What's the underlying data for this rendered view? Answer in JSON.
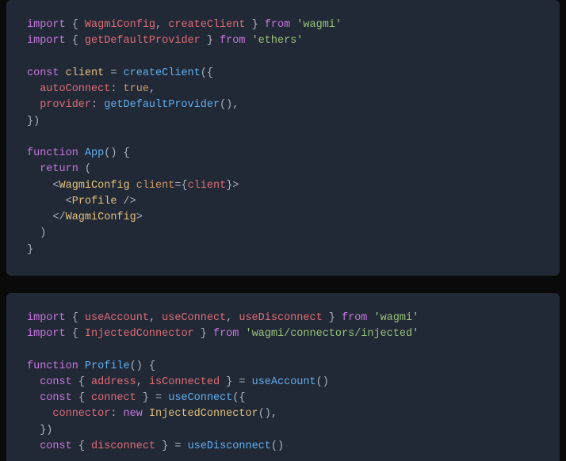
{
  "block1": {
    "l1_import": "import",
    "l1_lbrace": " { ",
    "l1_a": "WagmiConfig",
    "l1_comma": ", ",
    "l1_b": "createClient",
    "l1_rbrace": " } ",
    "l1_from": "from",
    "l1_sp": " ",
    "l1_str": "'wagmi'",
    "l2_import": "import",
    "l2_lbrace": " { ",
    "l2_a": "getDefaultProvider",
    "l2_rbrace": " } ",
    "l2_from": "from",
    "l2_sp": " ",
    "l2_str": "'ethers'",
    "l4_const": "const",
    "l4_sp1": " ",
    "l4_client": "client",
    "l4_eq": " = ",
    "l4_fn": "createClient",
    "l4_open": "({",
    "l5_pad": "  ",
    "l5_prop": "autoConnect",
    "l5_colon": ": ",
    "l5_val": "true",
    "l5_comma": ",",
    "l6_pad": "  ",
    "l6_prop": "provider",
    "l6_colon": ": ",
    "l6_fn": "getDefaultProvider",
    "l6_paren": "(),",
    "l7_close": "})",
    "l9_fn": "function",
    "l9_sp": " ",
    "l9_name": "App",
    "l9_paren": "() {",
    "l10_pad": "  ",
    "l10_ret": "return",
    "l10_paren": " (",
    "l11_pad": "    ",
    "l11_lt": "<",
    "l11_tag": "WagmiConfig",
    "l11_sp": " ",
    "l11_attr": "client",
    "l11_eq": "=",
    "l11_lbrace": "{",
    "l11_val": "client",
    "l11_rbrace": "}",
    "l11_gt": ">",
    "l12_pad": "      ",
    "l12_lt": "<",
    "l12_tag": "Profile",
    "l12_close": " />",
    "l13_pad": "    ",
    "l13_lt": "</",
    "l13_tag": "WagmiConfig",
    "l13_gt": ">",
    "l14_pad": "  ",
    "l14_paren": ")",
    "l15_brace": "}"
  },
  "block2": {
    "l1_import": "import",
    "l1_lbrace": " { ",
    "l1_a": "useAccount",
    "l1_c1": ", ",
    "l1_b": "useConnect",
    "l1_c2": ", ",
    "l1_c": "useDisconnect",
    "l1_rbrace": " } ",
    "l1_from": "from",
    "l1_sp": " ",
    "l1_str": "'wagmi'",
    "l2_import": "import",
    "l2_lbrace": " { ",
    "l2_a": "InjectedConnector",
    "l2_rbrace": " } ",
    "l2_from": "from",
    "l2_sp": " ",
    "l2_str": "'wagmi/connectors/injected'",
    "l4_fn": "function",
    "l4_sp": " ",
    "l4_name": "Profile",
    "l4_paren": "() {",
    "l5_pad": "  ",
    "l5_const": "const",
    "l5_lbrace": " { ",
    "l5_a": "address",
    "l5_c1": ", ",
    "l5_b": "isConnected",
    "l5_rbrace": " } = ",
    "l5_call": "useAccount",
    "l5_paren": "()",
    "l6_pad": "  ",
    "l6_const": "const",
    "l6_lbrace": " { ",
    "l6_a": "connect",
    "l6_rbrace": " } = ",
    "l6_call": "useConnect",
    "l6_paren": "({",
    "l7_pad": "    ",
    "l7_prop": "connector",
    "l7_colon": ": ",
    "l7_new": "new",
    "l7_sp": " ",
    "l7_cls": "InjectedConnector",
    "l7_paren": "(),",
    "l8_pad": "  ",
    "l8_close": "})",
    "l9_pad": "  ",
    "l9_const": "const",
    "l9_lbrace": " { ",
    "l9_a": "disconnect",
    "l9_rbrace": " } = ",
    "l9_call": "useDisconnect",
    "l9_paren": "()"
  }
}
